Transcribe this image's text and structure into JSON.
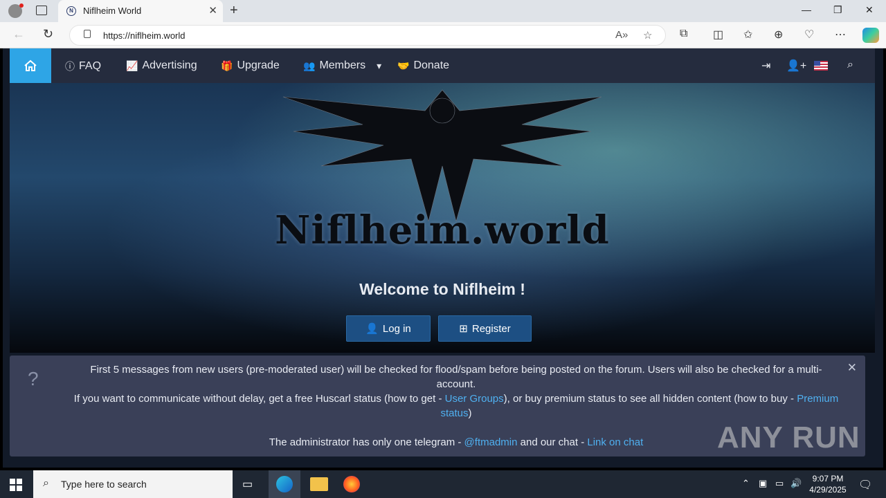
{
  "browser": {
    "tab_title": "Niflheim World",
    "url": "https://niflheim.world"
  },
  "site": {
    "nav": {
      "faq": "FAQ",
      "advertising": "Advertising",
      "upgrade": "Upgrade",
      "members": "Members",
      "donate": "Donate"
    },
    "logo_text": "Niflheim.world",
    "welcome": "Welcome to Niflheim !",
    "login_label": "Log in",
    "register_label": "Register",
    "notice": {
      "line1": "First 5 messages from new users (pre-moderated user) will be checked for flood/spam before being posted on the forum. Users will also be checked for a multi-account.",
      "line2_before": "If you want to communicate without delay, get a free Huscarl status (how to get - ",
      "user_groups_link": "User Groups",
      "line2_middle": "), or buy premium status to see all hidden content (how to buy - ",
      "premium_link": "Premium status",
      "line2_after": ")",
      "line3_before": "The administrator has only one telegram - ",
      "telegram_link": "@ftmadmin",
      "line3_middle": " and our chat - ",
      "chat_link": "Link on chat"
    }
  },
  "watermark": "ANY RUN",
  "taskbar": {
    "search_placeholder": "Type here to search",
    "time": "9:07 PM",
    "date": "4/29/2025"
  },
  "colors": {
    "nav_bg": "#252c3e",
    "home_accent": "#2ea5e6",
    "button_bg": "#1d4f83",
    "notice_bg": "#3a4058",
    "link": "#4fb0f0"
  }
}
